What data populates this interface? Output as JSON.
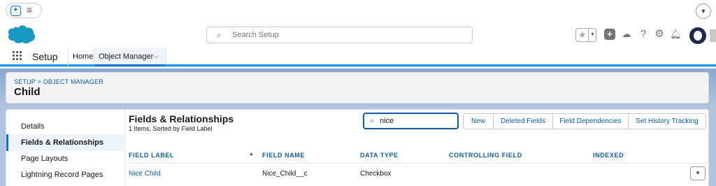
{
  "header": {
    "search_placeholder": "Search Setup"
  },
  "appnav": {
    "app_name": "Setup",
    "items": [
      {
        "label": "Home"
      },
      {
        "label": "Object Manager"
      }
    ]
  },
  "page": {
    "breadcrumb": "SETUP > OBJECT MANAGER",
    "title": "Child"
  },
  "sidebar": {
    "items": [
      {
        "label": "Details"
      },
      {
        "label": "Fields & Relationships"
      },
      {
        "label": "Page Layouts"
      },
      {
        "label": "Lightning Record Pages"
      }
    ],
    "active_index": 1
  },
  "main": {
    "title": "Fields & Relationships",
    "subtitle": "1 Items, Sorted by Field Label",
    "search_value": "nice",
    "buttons": [
      "New",
      "Deleted Fields",
      "Field Dependencies",
      "Set History Tracking"
    ],
    "columns": [
      "FIELD LABEL",
      "FIELD NAME",
      "DATA TYPE",
      "CONTROLLING FIELD",
      "INDEXED"
    ],
    "rows": [
      {
        "field_label": "Nice Child",
        "field_name": "Nice_Child__c",
        "data_type": "Checkbox",
        "controlling_field": "",
        "indexed": ""
      }
    ]
  },
  "icons": [
    "sparkle-icon",
    "menu-icon",
    "chevron-down-icon",
    "salesforce-cloud-logo",
    "search-icon",
    "star-icon",
    "plus-icon",
    "trailhead-icon",
    "help-icon",
    "gear-icon",
    "bell-icon",
    "avatar",
    "app-launcher-icon",
    "sort-ascending-icon",
    "row-actions-icon"
  ],
  "colors": {
    "brand_blue": "#0176d3",
    "link_blue": "#0b5cab",
    "page_background": "#b0c4df"
  }
}
